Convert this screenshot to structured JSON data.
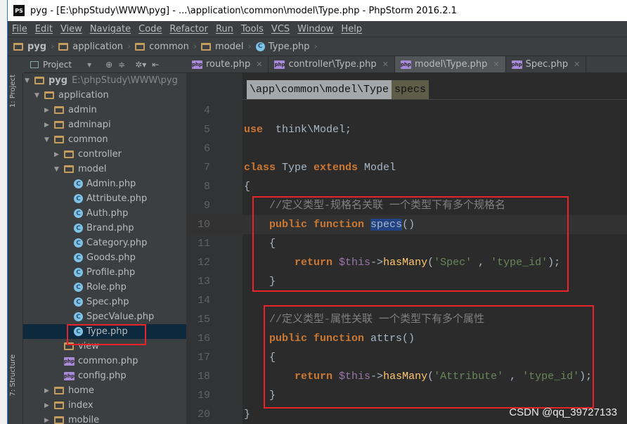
{
  "window": {
    "title": "pyg - [E:\\phpStudy\\WWW\\pyg] - ...\\application\\common\\model\\Type.php - PhpStorm 2016.2.1",
    "app_icon": "PS"
  },
  "menu": [
    "File",
    "Edit",
    "View",
    "Navigate",
    "Code",
    "Refactor",
    "Run",
    "Tools",
    "VCS",
    "Window",
    "Help"
  ],
  "breadcrumb": [
    "pyg",
    "application",
    "common",
    "model",
    "Type.php"
  ],
  "tool_windows": {
    "project": "1: Project",
    "structure": "7: Structure"
  },
  "project_panel": {
    "title": "Project"
  },
  "tabs": [
    {
      "label": "route.php",
      "active": false
    },
    {
      "label": "controller\\Type.php",
      "active": false
    },
    {
      "label": "model\\Type.php",
      "active": true
    },
    {
      "label": "Spec.php",
      "active": false
    }
  ],
  "editor_breadcrumb": {
    "namespace": "\\app\\common\\model\\Type",
    "method": "specs"
  },
  "tree": [
    {
      "label": "pyg",
      "extra": "E:\\phpStudy\\WWW\\pyg",
      "type": "folder",
      "depth": 0,
      "arrow": "open"
    },
    {
      "label": "application",
      "type": "folder",
      "depth": 1,
      "arrow": "open"
    },
    {
      "label": "admin",
      "type": "folder",
      "depth": 2,
      "arrow": "closed"
    },
    {
      "label": "adminapi",
      "type": "folder",
      "depth": 2,
      "arrow": "closed"
    },
    {
      "label": "common",
      "type": "folder",
      "depth": 2,
      "arrow": "open"
    },
    {
      "label": "controller",
      "type": "folder",
      "depth": 3,
      "arrow": "closed"
    },
    {
      "label": "model",
      "type": "folder",
      "depth": 3,
      "arrow": "open"
    },
    {
      "label": "Admin.php",
      "type": "class",
      "depth": 4
    },
    {
      "label": "Attribute.php",
      "type": "class",
      "depth": 4
    },
    {
      "label": "Auth.php",
      "type": "class",
      "depth": 4
    },
    {
      "label": "Brand.php",
      "type": "class",
      "depth": 4
    },
    {
      "label": "Category.php",
      "type": "class",
      "depth": 4
    },
    {
      "label": "Goods.php",
      "type": "class",
      "depth": 4
    },
    {
      "label": "Profile.php",
      "type": "class",
      "depth": 4
    },
    {
      "label": "Role.php",
      "type": "class",
      "depth": 4
    },
    {
      "label": "Spec.php",
      "type": "class",
      "depth": 4
    },
    {
      "label": "SpecValue.php",
      "type": "class",
      "depth": 4
    },
    {
      "label": "Type.php",
      "type": "class",
      "depth": 4,
      "selected": true
    },
    {
      "label": "view",
      "type": "folder",
      "depth": 3
    },
    {
      "label": "common.php",
      "type": "php",
      "depth": 3
    },
    {
      "label": "config.php",
      "type": "php",
      "depth": 3
    },
    {
      "label": "home",
      "type": "folder",
      "depth": 2,
      "arrow": "closed"
    },
    {
      "label": "index",
      "type": "folder",
      "depth": 2,
      "arrow": "closed"
    },
    {
      "label": "mobile",
      "type": "folder",
      "depth": 2,
      "arrow": "closed"
    }
  ],
  "code": [
    {
      "n": "4",
      "tokens": []
    },
    {
      "n": "5",
      "tokens": [
        [
          "kw",
          "use"
        ],
        [
          "",
          "  think\\Model;"
        ]
      ]
    },
    {
      "n": "6",
      "tokens": []
    },
    {
      "n": "7",
      "tokens": [
        [
          "kw",
          "class"
        ],
        [
          "",
          " Type "
        ],
        [
          "kw",
          "extends"
        ],
        [
          "",
          " Model"
        ]
      ]
    },
    {
      "n": "8",
      "tokens": [
        [
          "",
          "{"
        ]
      ]
    },
    {
      "n": "9",
      "tokens": [
        [
          "",
          "    "
        ],
        [
          "cm",
          "//定义类型-规格名关联 一个类型下有多个规格名"
        ]
      ]
    },
    {
      "n": "10",
      "tokens": [
        [
          "",
          "    "
        ],
        [
          "kw",
          "public function "
        ],
        [
          "hl",
          "specs"
        ],
        [
          "",
          "()"
        ]
      ],
      "current": true
    },
    {
      "n": "11",
      "tokens": [
        [
          "",
          "    {"
        ]
      ]
    },
    {
      "n": "12",
      "tokens": [
        [
          "",
          "        "
        ],
        [
          "kw",
          "return "
        ],
        [
          "var",
          "$this"
        ],
        [
          "",
          "->"
        ],
        [
          "fn",
          "hasMany"
        ],
        [
          "",
          "("
        ],
        [
          "str",
          "'Spec'"
        ],
        [
          "",
          " , "
        ],
        [
          "str",
          "'type_id'"
        ],
        [
          "",
          ");"
        ]
      ]
    },
    {
      "n": "13",
      "tokens": [
        [
          "",
          "    }"
        ]
      ]
    },
    {
      "n": "14",
      "tokens": []
    },
    {
      "n": "15",
      "tokens": [
        [
          "",
          "    "
        ],
        [
          "cm",
          "//定义类型-属性关联 一个类型下有多个属性"
        ]
      ]
    },
    {
      "n": "16",
      "tokens": [
        [
          "",
          "    "
        ],
        [
          "kw",
          "public function "
        ],
        [
          "",
          "attrs()"
        ]
      ]
    },
    {
      "n": "17",
      "tokens": [
        [
          "",
          "    {"
        ]
      ]
    },
    {
      "n": "18",
      "tokens": [
        [
          "",
          "        "
        ],
        [
          "kw",
          "return "
        ],
        [
          "var",
          "$this"
        ],
        [
          "",
          "->"
        ],
        [
          "fn",
          "hasMany"
        ],
        [
          "",
          "("
        ],
        [
          "str",
          "'Attribute'"
        ],
        [
          "",
          " , "
        ],
        [
          "str",
          "'type_id'"
        ],
        [
          "",
          ");"
        ]
      ]
    },
    {
      "n": "19",
      "tokens": [
        [
          "",
          "    }"
        ]
      ]
    },
    {
      "n": "20",
      "tokens": [
        [
          "",
          "}"
        ]
      ]
    }
  ],
  "watermark": "CSDN @qq_39727133"
}
